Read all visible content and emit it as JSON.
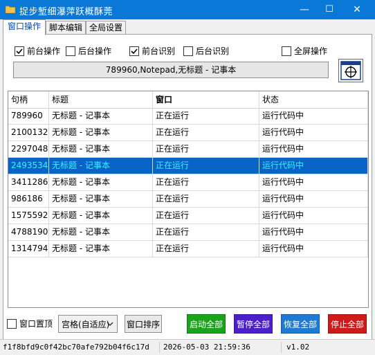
{
  "window": {
    "title": "捉步堑细瀑萍跃概酥莞",
    "minimize": "—",
    "maximize": "☐",
    "close": "✕"
  },
  "tabs": [
    {
      "label": "窗口操作",
      "active": true
    },
    {
      "label": "脚本编辑",
      "active": false
    },
    {
      "label": "全局设置",
      "active": false
    }
  ],
  "options": {
    "foreground_op": {
      "label": "前台操作",
      "checked": true
    },
    "background_op": {
      "label": "后台操作",
      "checked": false
    },
    "foreground_recog": {
      "label": "前台识别",
      "checked": true
    },
    "background_recog": {
      "label": "后台识别",
      "checked": false
    },
    "fullscreen_op": {
      "label": "全屏操作",
      "checked": false
    }
  },
  "target_info": "789960,Notepad,无标题 - 记事本",
  "table": {
    "columns": [
      "句柄",
      "标题",
      "窗口",
      "状态"
    ],
    "rows": [
      {
        "handle": "789960",
        "title": "无标题 - 记事本",
        "window": "正在运行",
        "status": "运行代码中",
        "selected": false
      },
      {
        "handle": "2100132",
        "title": "无标题 - 记事本",
        "window": "正在运行",
        "status": "运行代码中",
        "selected": false
      },
      {
        "handle": "2297048",
        "title": "无标题 - 记事本",
        "window": "正在运行",
        "status": "运行代码中",
        "selected": false
      },
      {
        "handle": "2493534",
        "title": "无标题 - 记事本",
        "window": "正在运行",
        "status": "运行代码中",
        "selected": true
      },
      {
        "handle": "3411286",
        "title": "无标题 - 记事本",
        "window": "正在运行",
        "status": "运行代码中",
        "selected": false
      },
      {
        "handle": "986186",
        "title": "无标题 - 记事本",
        "window": "正在运行",
        "status": "运行代码中",
        "selected": false
      },
      {
        "handle": "1575592",
        "title": "无标题 - 记事本",
        "window": "正在运行",
        "status": "运行代码中",
        "selected": false
      },
      {
        "handle": "4788190",
        "title": "无标题 - 记事本",
        "window": "正在运行",
        "status": "运行代码中",
        "selected": false
      },
      {
        "handle": "1314794",
        "title": "无标题 - 记事本",
        "window": "正在运行",
        "status": "运行代码中",
        "selected": false
      }
    ]
  },
  "bottom": {
    "pin_top": {
      "label": "窗口置顶",
      "checked": false
    },
    "layout_select": "宫格(自适应)",
    "sort_button": "窗口排序",
    "start_all": {
      "label": "启动全部",
      "color": "#1aa31a"
    },
    "pause_all": {
      "label": "暂停全部",
      "color": "#4b1fc9"
    },
    "resume_all": {
      "label": "恢复全部",
      "color": "#1f7ad4"
    },
    "stop_all": {
      "label": "停止全部",
      "color": "#d01a1a"
    }
  },
  "statusbar": {
    "hash": "f1f8bfd9c0f42bc70afe792b04f6c17d",
    "datetime": "2026-05-03 21:59:36",
    "version": "v1.02"
  },
  "icons": {
    "app": "folder-icon",
    "target_picker": "crosshair-window-icon"
  }
}
